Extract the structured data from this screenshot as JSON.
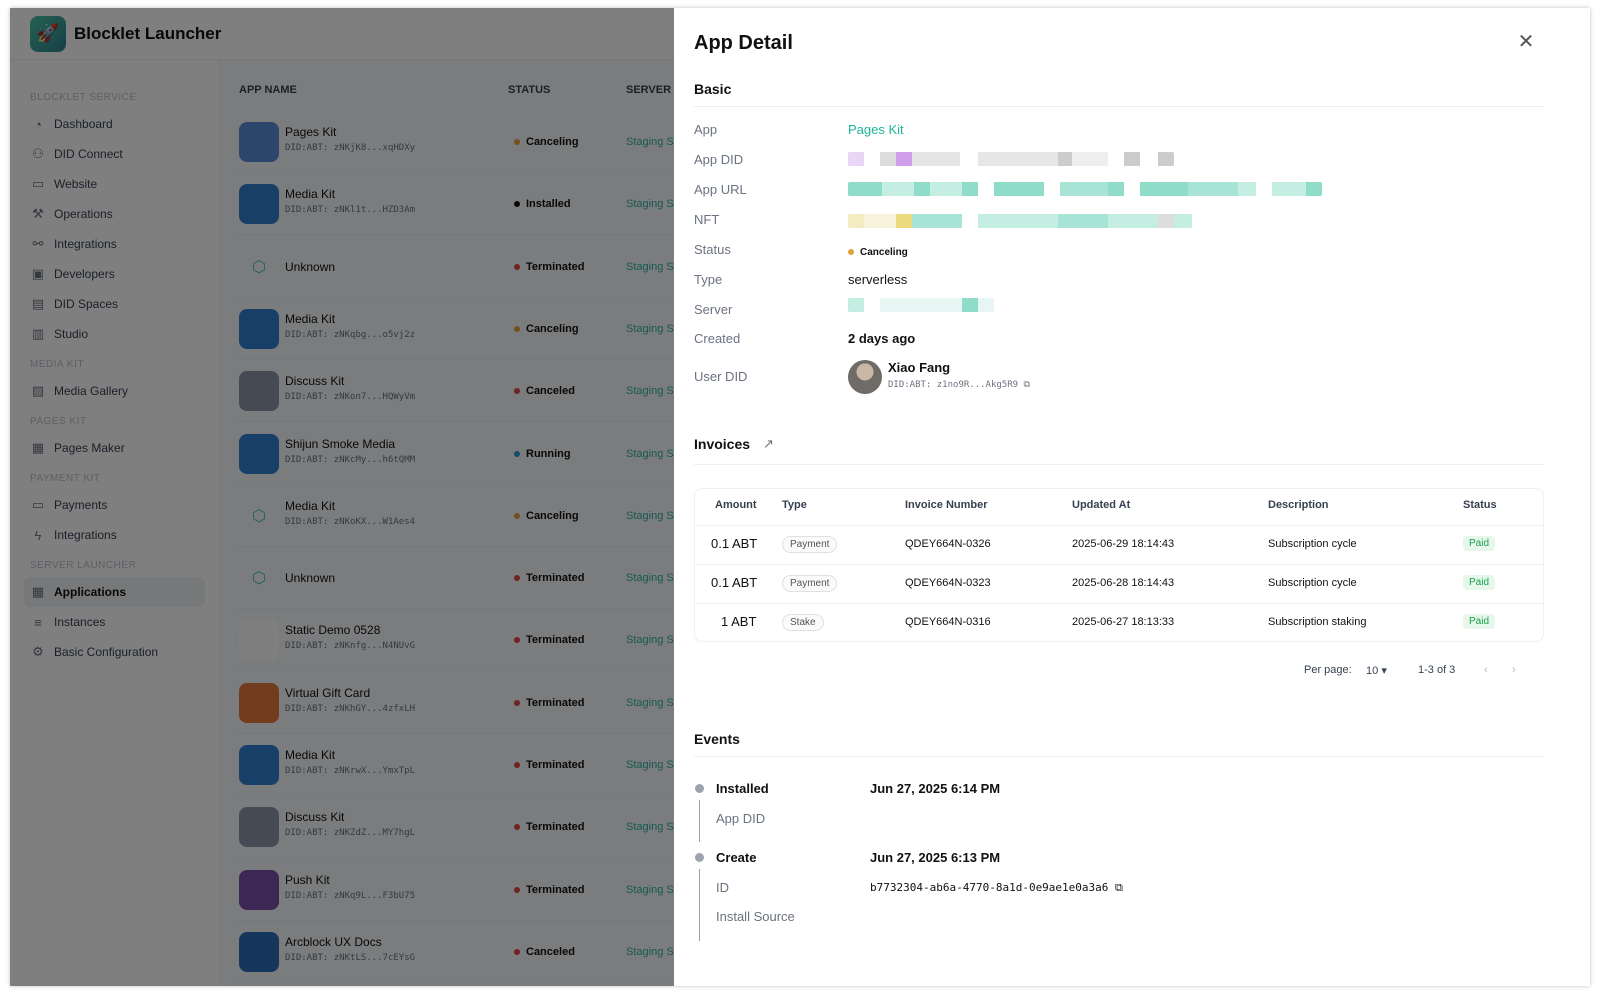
{
  "app": {
    "title": "Blocklet Launcher",
    "sidebar": [
      {
        "group": "BLOCKLET SERVICE",
        "items": [
          {
            "label": "Dashboard",
            "icon": "dashboard-icon"
          },
          {
            "label": "DID Connect",
            "icon": "did-connect-icon"
          },
          {
            "label": "Website",
            "icon": "website-icon"
          },
          {
            "label": "Operations",
            "icon": "operations-icon"
          },
          {
            "label": "Integrations",
            "icon": "integrations-icon"
          },
          {
            "label": "Developers",
            "icon": "developers-icon"
          },
          {
            "label": "DID Spaces",
            "icon": "did-spaces-icon"
          },
          {
            "label": "Studio",
            "icon": "studio-icon"
          }
        ]
      },
      {
        "group": "MEDIA KIT",
        "items": [
          {
            "label": "Media Gallery",
            "icon": "media-gallery-icon"
          }
        ]
      },
      {
        "group": "PAGES KIT",
        "items": [
          {
            "label": "Pages Maker",
            "icon": "pages-maker-icon"
          }
        ]
      },
      {
        "group": "PAYMENT KIT",
        "items": [
          {
            "label": "Payments",
            "icon": "payments-icon"
          },
          {
            "label": "Integrations",
            "icon": "bolt-icon"
          }
        ]
      },
      {
        "group": "SERVER LAUNCHER",
        "items": [
          {
            "label": "Applications",
            "icon": "applications-icon",
            "active": true
          },
          {
            "label": "Instances",
            "icon": "instances-icon"
          },
          {
            "label": "Basic Configuration",
            "icon": "settings-icon"
          }
        ]
      }
    ],
    "table_headers": {
      "name": "APP NAME",
      "status": "STATUS",
      "server": "SERVER"
    },
    "rows": [
      {
        "name": "Pages Kit",
        "did": "DID:ABT:  zNKjK8...xqHDXy",
        "status": "Canceling",
        "server": "Staging S"
      },
      {
        "name": "Media Kit",
        "did": "DID:ABT:  zNKl1t...HZD3Am",
        "status": "Installed",
        "server": "Staging S"
      },
      {
        "name": "Unknown",
        "did": "",
        "status": "Terminated",
        "server": "Staging S"
      },
      {
        "name": "Media Kit",
        "did": "DID:ABT:  zNKqbg...o5vj2z",
        "status": "Canceling",
        "server": "Staging S"
      },
      {
        "name": "Discuss Kit",
        "did": "DID:ABT:  zNKon7...HQWyVm",
        "status": "Canceled",
        "server": "Staging S"
      },
      {
        "name": "Shijun Smoke Media",
        "did": "DID:ABT:  zNKcMy...h6tQMM",
        "status": "Running",
        "server": "Staging S"
      },
      {
        "name": "Media Kit",
        "did": "DID:ABT:  zNKoKX...W1Aes4",
        "status": "Canceling",
        "server": "Staging S"
      },
      {
        "name": "Unknown",
        "did": "",
        "status": "Terminated",
        "server": "Staging S"
      },
      {
        "name": "Static Demo 0528",
        "did": "DID:ABT:  zNKnfg...N4NUvG",
        "status": "Terminated",
        "server": "Staging S"
      },
      {
        "name": "Virtual Gift Card",
        "did": "DID:ABT:  zNKhGY...4zfxLH",
        "status": "Terminated",
        "server": "Staging S"
      },
      {
        "name": "Media Kit",
        "did": "DID:ABT:  zNKrwX...YmxTpL",
        "status": "Terminated",
        "server": "Staging S"
      },
      {
        "name": "Discuss Kit",
        "did": "DID:ABT:  zNKZdZ...MY7hgL",
        "status": "Terminated",
        "server": "Staging S"
      },
      {
        "name": "Push Kit",
        "did": "DID:ABT:  zNKq9L...F3bU75",
        "status": "Terminated",
        "server": "Staging S"
      },
      {
        "name": "Arcblock UX Docs",
        "did": "DID:ABT:  zNKtLS...7cEYsG",
        "status": "Canceled",
        "server": "Staging S"
      }
    ]
  },
  "drawer": {
    "title": "App Detail",
    "basic_title": "Basic",
    "labels": {
      "app": "App",
      "app_did": "App DID",
      "app_url": "App URL",
      "nft": "NFT",
      "status": "Status",
      "type": "Type",
      "server": "Server",
      "created": "Created",
      "user_did": "User DID"
    },
    "values": {
      "app": "Pages Kit",
      "status": "Canceling",
      "type": "serverless",
      "created": "2 days ago"
    },
    "user": {
      "name": "Xiao Fang",
      "did": "DID:ABT:  z1no9R...Akg5R9"
    },
    "invoices_title": "Invoices",
    "invoice_headers": [
      "Amount",
      "Type",
      "Invoice Number",
      "Updated At",
      "Description",
      "Status"
    ],
    "invoices": [
      {
        "amount": "0.1 ABT",
        "type": "Payment",
        "number": "QDEY664N-0326",
        "updated": "2025-06-29 18:14:43",
        "desc": "Subscription cycle",
        "status": "Paid"
      },
      {
        "amount": "0.1 ABT",
        "type": "Payment",
        "number": "QDEY664N-0323",
        "updated": "2025-06-28 18:14:43",
        "desc": "Subscription cycle",
        "status": "Paid"
      },
      {
        "amount": "1 ABT",
        "type": "Stake",
        "number": "QDEY664N-0316",
        "updated": "2025-06-27 18:13:33",
        "desc": "Subscription staking",
        "status": "Paid"
      }
    ],
    "pager": {
      "per_page_label": "Per page:",
      "per_page": "10",
      "range": "1-3 of 3"
    },
    "events_title": "Events",
    "events": [
      {
        "name": "Installed",
        "time": "Jun 27, 2025 6:14 PM",
        "sub": "App DID"
      },
      {
        "name": "Create",
        "time": "Jun 27, 2025 6:13 PM",
        "id_label": "ID",
        "id_value": "b7732304-ab6a-4770-8a1d-0e9ae1e0a3a6",
        "source_label": "Install Source"
      }
    ]
  }
}
